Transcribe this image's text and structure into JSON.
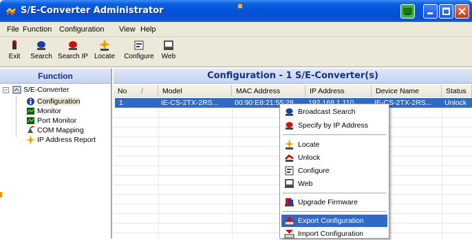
{
  "window": {
    "title": "S/E-Converter Administrator"
  },
  "menu": [
    "File",
    "Function",
    "Configuration",
    "View",
    "Help"
  ],
  "toolbar": {
    "exit": "Exit",
    "search": "Search",
    "search_ip": "Search IP",
    "locate": "Locate",
    "configure": "Configure",
    "web": "Web"
  },
  "left": {
    "header": "Function",
    "root": "S/E-Converter",
    "items": [
      "Configuration",
      "Monitor",
      "Port Monitor",
      "COM Mapping",
      "IP Address Report"
    ]
  },
  "right": {
    "header": "Configuration - 1 S/E-Converter(s)",
    "columns": [
      "No",
      "Model",
      "MAC Address",
      "IP Address",
      "Device Name",
      "Status"
    ],
    "rows": [
      {
        "no": "1",
        "model": "IE-CS-2TX-2RS...",
        "mac": "00:90:E8:21:55:28",
        "ip": "192.168.1.110",
        "device": "IE-CS-2TX-2RS...",
        "status": "Unlock"
      }
    ]
  },
  "context_menu": {
    "items": [
      "Broadcast Search",
      "Specify by IP Address",
      "Locate",
      "Unlock",
      "Configure",
      "Web",
      "Upgrade Firmware",
      "Export Configuration",
      "Import Configuration"
    ],
    "highlighted": "Export Configuration"
  },
  "colors": {
    "title_bar": "#0452d8",
    "selection": "#316ac5",
    "header_text": "#15308a",
    "panel_bg": "#ece9d8"
  }
}
